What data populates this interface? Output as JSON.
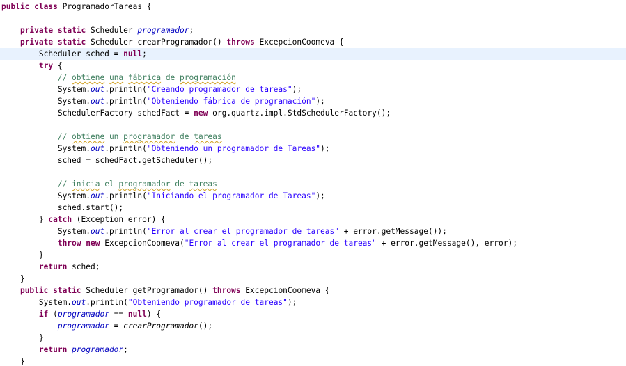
{
  "editor": {
    "current_line_index": 4,
    "lines": [
      {
        "indent": 0,
        "tokens": [
          {
            "t": "kw",
            "v": "public"
          },
          {
            "t": "p",
            "v": " "
          },
          {
            "t": "kw",
            "v": "class"
          },
          {
            "t": "p",
            "v": " ProgramadorTareas {"
          }
        ]
      },
      {
        "indent": 0,
        "tokens": []
      },
      {
        "indent": 1,
        "tokens": [
          {
            "t": "kw",
            "v": "private"
          },
          {
            "t": "p",
            "v": " "
          },
          {
            "t": "kw",
            "v": "static"
          },
          {
            "t": "p",
            "v": " Scheduler "
          },
          {
            "t": "fld",
            "v": "programador"
          },
          {
            "t": "p",
            "v": ";"
          }
        ]
      },
      {
        "indent": 1,
        "tokens": [
          {
            "t": "kw",
            "v": "private"
          },
          {
            "t": "p",
            "v": " "
          },
          {
            "t": "kw",
            "v": "static"
          },
          {
            "t": "p",
            "v": " Scheduler crearProgramador() "
          },
          {
            "t": "kw",
            "v": "throws"
          },
          {
            "t": "p",
            "v": " ExcepcionCoomeva {"
          }
        ]
      },
      {
        "indent": 2,
        "tokens": [
          {
            "t": "p",
            "v": "Scheduler sched = "
          },
          {
            "t": "kw",
            "v": "null"
          },
          {
            "t": "p",
            "v": ";"
          }
        ]
      },
      {
        "indent": 2,
        "tokens": [
          {
            "t": "kw",
            "v": "try"
          },
          {
            "t": "p",
            "v": " {"
          }
        ]
      },
      {
        "indent": 3,
        "tokens": [
          {
            "t": "cm",
            "v": "// "
          },
          {
            "t": "cmsp",
            "v": "obtiene"
          },
          {
            "t": "cm",
            "v": " "
          },
          {
            "t": "cmsp",
            "v": "una"
          },
          {
            "t": "cm",
            "v": " "
          },
          {
            "t": "cmsp",
            "v": "fábrica"
          },
          {
            "t": "cm",
            "v": " de "
          },
          {
            "t": "cmsp",
            "v": "programación"
          }
        ]
      },
      {
        "indent": 3,
        "tokens": [
          {
            "t": "p",
            "v": "System."
          },
          {
            "t": "sfld",
            "v": "out"
          },
          {
            "t": "p",
            "v": ".println("
          },
          {
            "t": "str",
            "v": "\"Creando programador de tareas\""
          },
          {
            "t": "p",
            "v": ");"
          }
        ]
      },
      {
        "indent": 3,
        "tokens": [
          {
            "t": "p",
            "v": "System."
          },
          {
            "t": "sfld",
            "v": "out"
          },
          {
            "t": "p",
            "v": ".println("
          },
          {
            "t": "str",
            "v": "\"Obteniendo fábrica de programación\""
          },
          {
            "t": "p",
            "v": ");"
          }
        ]
      },
      {
        "indent": 3,
        "tokens": [
          {
            "t": "p",
            "v": "SchedulerFactory schedFact = "
          },
          {
            "t": "kw",
            "v": "new"
          },
          {
            "t": "p",
            "v": " org.quartz.impl.StdSchedulerFactory();"
          }
        ]
      },
      {
        "indent": 0,
        "tokens": []
      },
      {
        "indent": 3,
        "tokens": [
          {
            "t": "cm",
            "v": "// "
          },
          {
            "t": "cmsp",
            "v": "obtiene"
          },
          {
            "t": "cm",
            "v": " un "
          },
          {
            "t": "cmsp",
            "v": "programador"
          },
          {
            "t": "cm",
            "v": " de "
          },
          {
            "t": "cmsp",
            "v": "tareas"
          }
        ]
      },
      {
        "indent": 3,
        "tokens": [
          {
            "t": "p",
            "v": "System."
          },
          {
            "t": "sfld",
            "v": "out"
          },
          {
            "t": "p",
            "v": ".println("
          },
          {
            "t": "str",
            "v": "\"Obteniendo un programador de Tareas\""
          },
          {
            "t": "p",
            "v": ");"
          }
        ]
      },
      {
        "indent": 3,
        "tokens": [
          {
            "t": "p",
            "v": "sched = schedFact.getScheduler();"
          }
        ]
      },
      {
        "indent": 0,
        "tokens": []
      },
      {
        "indent": 3,
        "tokens": [
          {
            "t": "cm",
            "v": "// "
          },
          {
            "t": "cmsp",
            "v": "inicia"
          },
          {
            "t": "cm",
            "v": " el "
          },
          {
            "t": "cmsp",
            "v": "programador"
          },
          {
            "t": "cm",
            "v": " de "
          },
          {
            "t": "cmsp",
            "v": "tareas"
          }
        ]
      },
      {
        "indent": 3,
        "tokens": [
          {
            "t": "p",
            "v": "System."
          },
          {
            "t": "sfld",
            "v": "out"
          },
          {
            "t": "p",
            "v": ".println("
          },
          {
            "t": "str",
            "v": "\"Iniciando el programador de Tareas\""
          },
          {
            "t": "p",
            "v": ");"
          }
        ]
      },
      {
        "indent": 3,
        "tokens": [
          {
            "t": "p",
            "v": "sched.start();"
          }
        ]
      },
      {
        "indent": 2,
        "tokens": [
          {
            "t": "p",
            "v": "} "
          },
          {
            "t": "kw",
            "v": "catch"
          },
          {
            "t": "p",
            "v": " (Exception error) {"
          }
        ]
      },
      {
        "indent": 3,
        "tokens": [
          {
            "t": "p",
            "v": "System."
          },
          {
            "t": "sfld",
            "v": "out"
          },
          {
            "t": "p",
            "v": ".println("
          },
          {
            "t": "str",
            "v": "\"Error al crear el programador de tareas\""
          },
          {
            "t": "p",
            "v": " + error.getMessage());"
          }
        ]
      },
      {
        "indent": 3,
        "tokens": [
          {
            "t": "kw",
            "v": "throw"
          },
          {
            "t": "p",
            "v": " "
          },
          {
            "t": "kw",
            "v": "new"
          },
          {
            "t": "p",
            "v": " ExcepcionCoomeva("
          },
          {
            "t": "str",
            "v": "\"Error al crear el programador de tareas\""
          },
          {
            "t": "p",
            "v": " + error.getMessage(), error);"
          }
        ]
      },
      {
        "indent": 2,
        "tokens": [
          {
            "t": "p",
            "v": "}"
          }
        ]
      },
      {
        "indent": 2,
        "tokens": [
          {
            "t": "kw",
            "v": "return"
          },
          {
            "t": "p",
            "v": " sched;"
          }
        ]
      },
      {
        "indent": 1,
        "tokens": [
          {
            "t": "p",
            "v": "}"
          }
        ]
      },
      {
        "indent": 1,
        "tokens": [
          {
            "t": "kw",
            "v": "public"
          },
          {
            "t": "p",
            "v": " "
          },
          {
            "t": "kw",
            "v": "static"
          },
          {
            "t": "p",
            "v": " Scheduler getProgramador() "
          },
          {
            "t": "kw",
            "v": "throws"
          },
          {
            "t": "p",
            "v": " ExcepcionCoomeva {"
          }
        ]
      },
      {
        "indent": 2,
        "tokens": [
          {
            "t": "p",
            "v": "System."
          },
          {
            "t": "sfld",
            "v": "out"
          },
          {
            "t": "p",
            "v": ".println("
          },
          {
            "t": "str",
            "v": "\"Obteniendo programador de tareas\""
          },
          {
            "t": "p",
            "v": ");"
          }
        ]
      },
      {
        "indent": 2,
        "tokens": [
          {
            "t": "kw",
            "v": "if"
          },
          {
            "t": "p",
            "v": " ("
          },
          {
            "t": "fld",
            "v": "programador"
          },
          {
            "t": "p",
            "v": " == "
          },
          {
            "t": "kw",
            "v": "null"
          },
          {
            "t": "p",
            "v": ") {"
          }
        ]
      },
      {
        "indent": 3,
        "tokens": [
          {
            "t": "fld",
            "v": "programador"
          },
          {
            "t": "p",
            "v": " = "
          },
          {
            "t": "mth",
            "v": "crearProgramador"
          },
          {
            "t": "p",
            "v": "();"
          }
        ]
      },
      {
        "indent": 2,
        "tokens": [
          {
            "t": "p",
            "v": "}"
          }
        ]
      },
      {
        "indent": 2,
        "tokens": [
          {
            "t": "kw",
            "v": "return"
          },
          {
            "t": "p",
            "v": " "
          },
          {
            "t": "fld",
            "v": "programador"
          },
          {
            "t": "p",
            "v": ";"
          }
        ]
      },
      {
        "indent": 1,
        "tokens": [
          {
            "t": "p",
            "v": "}"
          }
        ]
      }
    ]
  },
  "colors": {
    "keyword": "#7f0055",
    "string": "#2a00ff",
    "comment": "#3f7f5f",
    "field": "#0000c0",
    "current_line_highlight": "#e8f2fe",
    "background": "#ffffff"
  }
}
